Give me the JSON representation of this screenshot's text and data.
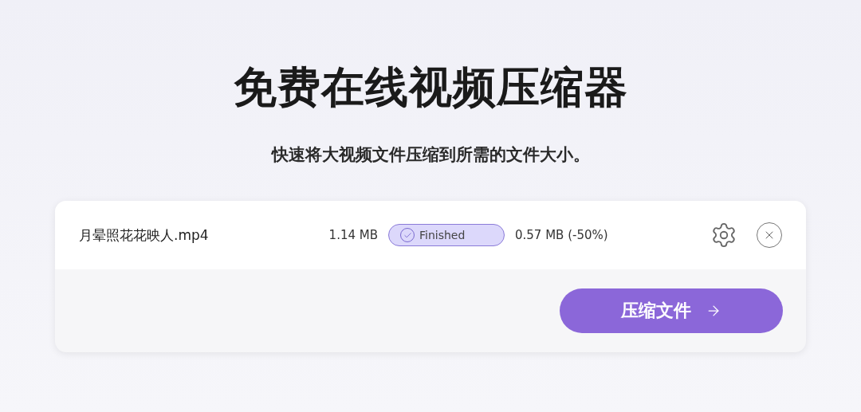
{
  "title": "免费在线视频压缩器",
  "subtitle": "快速将大视频文件压缩到所需的文件大小。",
  "files": [
    {
      "name": "月晕照花花映人.mp4",
      "original_size": "1.14 MB",
      "status": {
        "kind": "finished",
        "label": "Finished"
      },
      "result": "0.57 MB (-50%)"
    }
  ],
  "compress_button": {
    "label": "压缩文件"
  }
}
